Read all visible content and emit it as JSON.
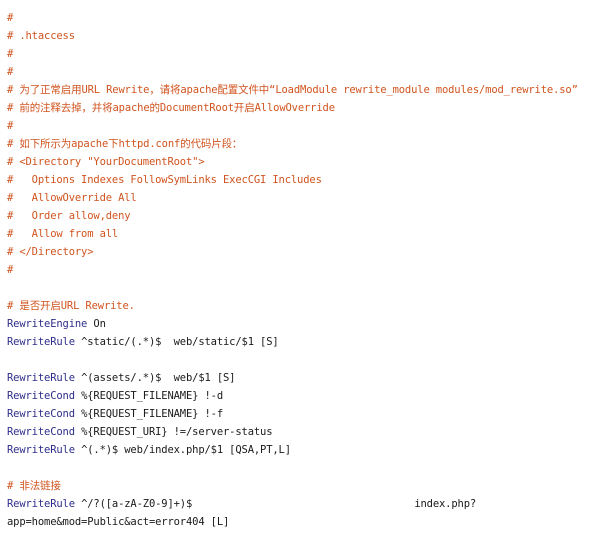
{
  "colors": {
    "background": "#ffffff",
    "comment": "#d0541f",
    "directive": "#2e2e8a",
    "text": "#1a1a1a"
  },
  "lines": [
    [
      {
        "t": "#",
        "c": "cm"
      }
    ],
    [
      {
        "t": "# .htaccess",
        "c": "cm"
      }
    ],
    [
      {
        "t": "#",
        "c": "cm"
      }
    ],
    [
      {
        "t": "#",
        "c": "cm"
      }
    ],
    [
      {
        "t": "# 为了正常启用URL Rewrite，请将apache配置文件中“LoadModule rewrite_module modules/mod_rewrite.so”",
        "c": "cm"
      }
    ],
    [
      {
        "t": "# 前的注释去掉，并将apache的DocumentRoot开启AllowOverride",
        "c": "cm"
      }
    ],
    [
      {
        "t": "#",
        "c": "cm"
      }
    ],
    [
      {
        "t": "# 如下所示为apache下httpd.conf的代码片段：",
        "c": "cm"
      }
    ],
    [
      {
        "t": "# <Directory \"YourDocumentRoot\">",
        "c": "cm"
      }
    ],
    [
      {
        "t": "#   Options Indexes FollowSymLinks ExecCGI Includes",
        "c": "cm"
      }
    ],
    [
      {
        "t": "#   AllowOverride All",
        "c": "cm"
      }
    ],
    [
      {
        "t": "#   Order allow,deny",
        "c": "cm"
      }
    ],
    [
      {
        "t": "#   Allow from all",
        "c": "cm"
      }
    ],
    [
      {
        "t": "# </Directory>",
        "c": "cm"
      }
    ],
    [
      {
        "t": "#",
        "c": "cm"
      }
    ],
    [],
    [
      {
        "t": "# 是否开启URL Rewrite.",
        "c": "cm"
      }
    ],
    [
      {
        "t": "RewriteEngine ",
        "c": "kw"
      },
      {
        "t": "On",
        "c": "tx"
      }
    ],
    [
      {
        "t": "RewriteRule ",
        "c": "kw"
      },
      {
        "t": "^static/(.*)$  web/static/$1 [S]",
        "c": "tx"
      }
    ],
    [],
    [
      {
        "t": "RewriteRule ",
        "c": "kw"
      },
      {
        "t": "^(assets/.*)$  web/$1 [S]",
        "c": "tx"
      }
    ],
    [
      {
        "t": "RewriteCond ",
        "c": "kw"
      },
      {
        "t": "%{REQUEST_FILENAME} !-d",
        "c": "tx"
      }
    ],
    [
      {
        "t": "RewriteCond ",
        "c": "kw"
      },
      {
        "t": "%{REQUEST_FILENAME} !-f",
        "c": "tx"
      }
    ],
    [
      {
        "t": "RewriteCond ",
        "c": "kw"
      },
      {
        "t": "%{REQUEST_URI} !=/server-status",
        "c": "tx"
      }
    ],
    [
      {
        "t": "RewriteRule ",
        "c": "kw"
      },
      {
        "t": "^(.*)$ web/index.php/$1 [QSA,PT,L]",
        "c": "tx"
      }
    ],
    [],
    [
      {
        "t": "# 非法链接",
        "c": "cm"
      }
    ],
    [
      {
        "t": "RewriteRule ",
        "c": "kw"
      },
      {
        "t": "^/?([a-zA-Z0-9]+)$                                    index.php?",
        "c": "tx"
      }
    ],
    [
      {
        "t": "app=home&mod=Public&act=error404 [L]",
        "c": "tx"
      }
    ]
  ]
}
